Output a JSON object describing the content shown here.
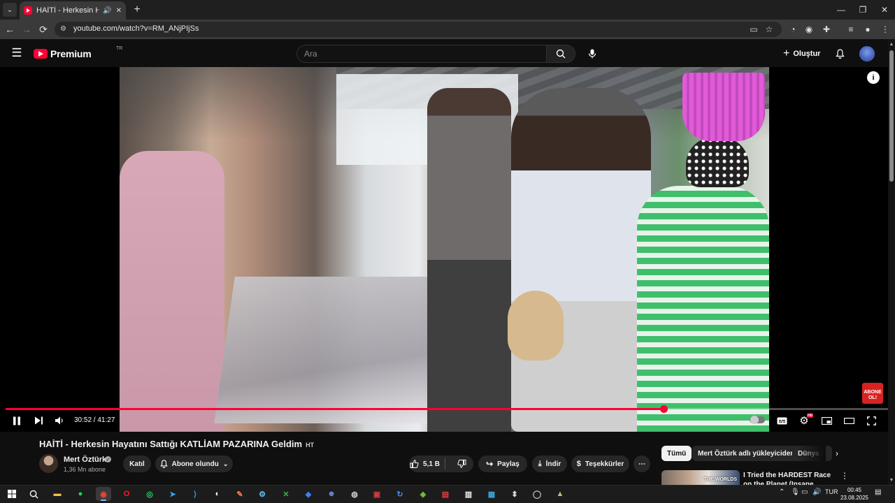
{
  "browser": {
    "tab_title": "HAİTİ - Herkesin Hayatını S",
    "url": "youtube.com/watch?v=RM_ANjPIjSs"
  },
  "masthead": {
    "logo_text": "Premium",
    "country_code": "TR",
    "search_placeholder": "Ara",
    "create_label": "Oluştur"
  },
  "player": {
    "current_time": "30:52",
    "duration": "41:27",
    "time_display": "30:52 / 41:27",
    "progress_fraction": 0.7446,
    "hd_label": "HD",
    "info_glyph": "i",
    "subscribe_overlay": [
      "ABONE",
      "OL!"
    ]
  },
  "video": {
    "title": "HAİTİ - Herkesin Hayatını Sattığı KATLİAM PAZARINA Geldim",
    "title_badge": "HT",
    "channel_name": "Mert Öztürk",
    "subscriber_count": "1,36 Mn abone",
    "join_label": "Katıl",
    "subscribed_label": "Abone olundu",
    "like_count": "5,1 B",
    "share_label": "Paylaş",
    "download_label": "İndir",
    "thanks_label": "Teşekkürler"
  },
  "chips": [
    "Tümü",
    "Mert Öztürk adlı yükleyiciden",
    "Dünya H"
  ],
  "recommended": [
    {
      "thumb_label": "THE WORLDS",
      "title": "I Tried the HARDEST Race on the Planet (Insane Challenge)"
    }
  ],
  "taskbar": {
    "language": "TUR",
    "time": "00:45",
    "date": "23.08.2025"
  },
  "colors": {
    "accent": "#ff0033",
    "background": "#0f0f0f",
    "pill": "#272727",
    "text_secondary": "#aaaaaa"
  }
}
